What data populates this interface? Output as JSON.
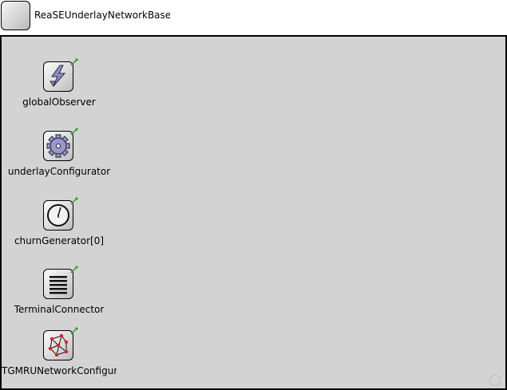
{
  "parent": {
    "title": "ReaSEUnderlayNetworkBase"
  },
  "modules": [
    {
      "id": "globalObserver",
      "label": "globalObserver",
      "icon": "lightning-icon"
    },
    {
      "id": "underlayConfigurator",
      "label": "underlayConfigurator",
      "icon": "gear-icon"
    },
    {
      "id": "churnGenerator",
      "label": "churnGenerator[0]",
      "icon": "clock-icon"
    },
    {
      "id": "terminalConnector",
      "label": "TerminalConnector",
      "icon": "list-icon"
    },
    {
      "id": "networkConfigurator",
      "label": "TGMRUNetworkConfigurator",
      "icon": "network-icon"
    }
  ],
  "colors": {
    "canvas": "#d3d3d3",
    "pin": "#2e9e2e",
    "network_node": "#e02020",
    "gear": "#9b97c9"
  }
}
